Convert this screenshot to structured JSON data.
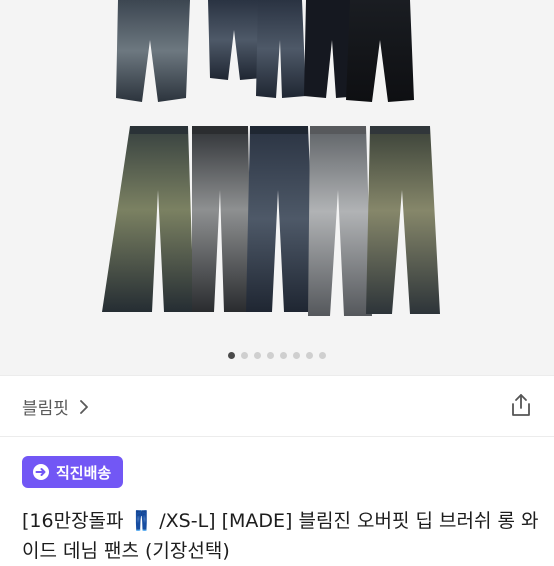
{
  "gallery": {
    "total_slides": 8,
    "active_index": 0
  },
  "store": {
    "name": "블림핏"
  },
  "badge": {
    "label": "직진배송"
  },
  "product": {
    "title": "[16만장돌파 👖 /XS-L] [MADE] 블림진 오버핏 딥 브러쉬 롱 와이드 데님 팬츠 (기장선택)"
  },
  "colors": {
    "accent": "#7257f5",
    "dot_active": "#4a4a4a",
    "dot_inactive": "#cfcfcf"
  }
}
